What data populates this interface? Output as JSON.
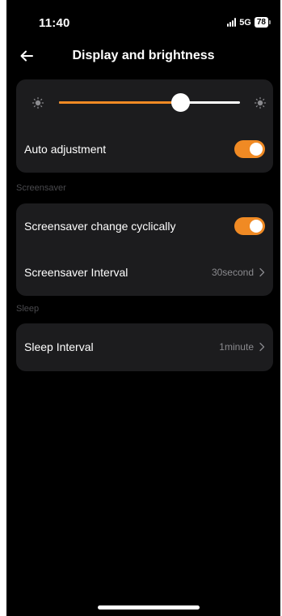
{
  "status_bar": {
    "time": "11:40",
    "network": "5G",
    "battery": "78"
  },
  "header": {
    "title": "Display and brightness",
    "back_icon": "arrow-left-icon"
  },
  "brightness": {
    "level": 0.67,
    "icon_low": "sun-icon",
    "icon_high": "sun-icon",
    "auto_label": "Auto adjustment",
    "auto_enabled": true
  },
  "screensaver": {
    "section_label": "Screensaver",
    "cyclic_label": "Screensaver change cyclically",
    "cyclic_enabled": true,
    "interval_label": "Screensaver Interval",
    "interval_value": "30second"
  },
  "sleep": {
    "section_label": "Sleep",
    "interval_label": "Sleep Interval",
    "interval_value": "1minute"
  },
  "colors": {
    "accent": "#f08a24",
    "background": "#000000",
    "card": "#1c1c1e",
    "secondary_text": "#8a8a8e",
    "section_text": "#4a4a4e"
  }
}
